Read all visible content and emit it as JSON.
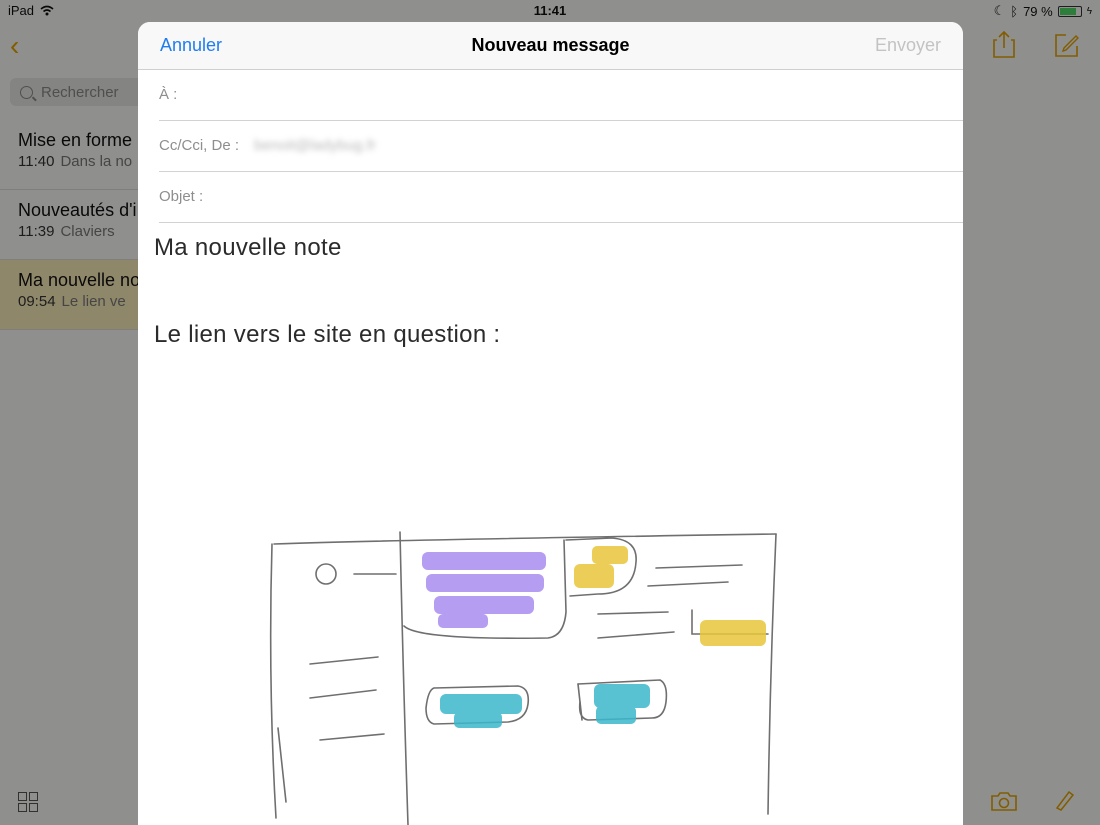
{
  "status_bar": {
    "device": "iPad",
    "time": "11:41",
    "battery": "79 %",
    "battery_level": 0.79
  },
  "sidebar": {
    "search_placeholder": "Rechercher",
    "notes": [
      {
        "title": "Mise en forme",
        "time": "11:40",
        "preview": "Dans la no"
      },
      {
        "title": "Nouveautés d'i",
        "time": "11:39",
        "preview": "Claviers"
      },
      {
        "title": "Ma nouvelle no",
        "time": "09:54",
        "preview": "Le lien ve"
      }
    ]
  },
  "compose": {
    "cancel_label": "Annuler",
    "title": "Nouveau message",
    "send_label": "Envoyer",
    "to_label": "À :",
    "cc_label": "Cc/Cci, De :",
    "from_value": "benoit@ladybug.fr",
    "subject_label": "Objet :",
    "body_line1": "Ma nouvelle note",
    "body_line2": "Le lien vers le site en question :"
  },
  "colors": {
    "accent": "#1e7df0",
    "notes_yellow": "#e0a000",
    "purple": "#a98cf0",
    "teal": "#3bb8cc",
    "yellow": "#e8c53a"
  },
  "icons": [
    "back-chevron-icon",
    "wifi-icon",
    "moon-icon",
    "bluetooth-icon",
    "battery-icon",
    "search-icon",
    "share-icon",
    "compose-icon",
    "grid-icon",
    "camera-icon",
    "pen-icon"
  ]
}
